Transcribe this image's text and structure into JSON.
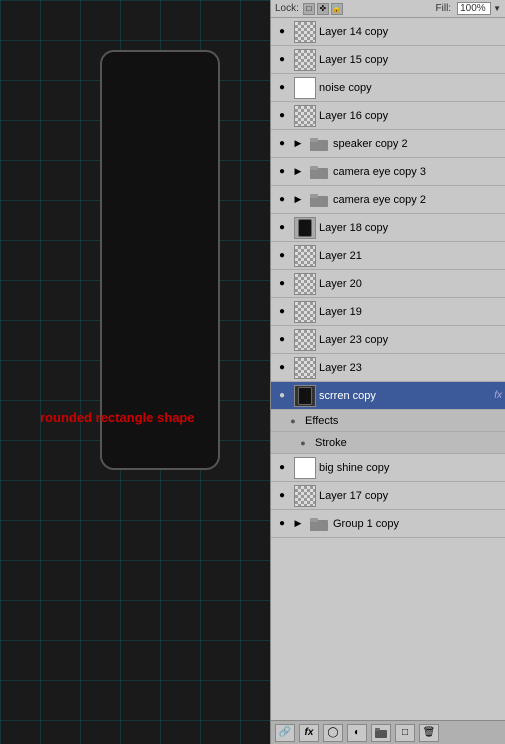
{
  "topBar": {
    "lockLabel": "Lock:",
    "fillLabel": "Fill:",
    "fillValue": "100%",
    "icons": [
      "lock-transparent",
      "lock-position",
      "lock-all"
    ]
  },
  "layers": [
    {
      "id": "layer14copy",
      "name": "Layer 14 copy",
      "type": "layer",
      "thumb": "checker",
      "visible": true,
      "selected": false,
      "fx": false
    },
    {
      "id": "layer15copy",
      "name": "Layer 15 copy",
      "type": "layer",
      "thumb": "checker",
      "visible": true,
      "selected": false,
      "fx": false
    },
    {
      "id": "noisecopy",
      "name": "noise copy",
      "type": "layer",
      "thumb": "white-bg",
      "visible": true,
      "selected": false,
      "fx": false
    },
    {
      "id": "layer16copy",
      "name": "Layer 16 copy",
      "type": "layer",
      "thumb": "checker",
      "visible": true,
      "selected": false,
      "fx": false
    },
    {
      "id": "speakercopy2",
      "name": "speaker copy 2",
      "type": "group",
      "visible": true,
      "selected": false,
      "expanded": false
    },
    {
      "id": "cameraeyecopy3",
      "name": "camera eye copy 3",
      "type": "group",
      "visible": true,
      "selected": false,
      "expanded": false
    },
    {
      "id": "cameraeyecopy2",
      "name": "camera eye copy 2",
      "type": "group",
      "visible": true,
      "selected": false,
      "expanded": false
    },
    {
      "id": "layer18copy",
      "name": "Layer 18 copy",
      "type": "layer",
      "thumb": "checker",
      "visible": true,
      "selected": false,
      "fx": false
    },
    {
      "id": "layer21",
      "name": "Layer 21",
      "type": "layer",
      "thumb": "checker",
      "visible": true,
      "selected": false,
      "fx": false
    },
    {
      "id": "layer20",
      "name": "Layer 20",
      "type": "layer",
      "thumb": "checker",
      "visible": true,
      "selected": false,
      "fx": false
    },
    {
      "id": "layer19",
      "name": "Layer 19",
      "type": "layer",
      "thumb": "checker",
      "visible": true,
      "selected": false,
      "fx": false
    },
    {
      "id": "layer23copy",
      "name": "Layer 23 copy",
      "type": "layer",
      "thumb": "checker",
      "visible": true,
      "selected": false,
      "fx": false
    },
    {
      "id": "layer23",
      "name": "Layer 23",
      "type": "layer",
      "thumb": "checker",
      "visible": true,
      "selected": false,
      "fx": false
    },
    {
      "id": "scrrencopY",
      "name": "scrren copy",
      "type": "layer",
      "thumb": "dark-bg",
      "visible": true,
      "selected": true,
      "fx": true
    },
    {
      "id": "effects-header",
      "name": "Effects",
      "type": "effects",
      "visible": true
    },
    {
      "id": "effects-stroke",
      "name": "Stroke",
      "type": "effect-item",
      "visible": true
    },
    {
      "id": "bigshinecopY",
      "name": "big shine copy",
      "type": "layer",
      "thumb": "white-bg",
      "visible": true,
      "selected": false,
      "fx": false
    },
    {
      "id": "layer17copy",
      "name": "Layer 17 copy",
      "type": "layer",
      "thumb": "checker",
      "visible": true,
      "selected": false,
      "fx": false
    },
    {
      "id": "group1copy",
      "name": "Group 1 copy",
      "type": "group",
      "visible": true,
      "selected": false,
      "expanded": false
    }
  ],
  "bottomBar": {
    "buttons": [
      "link-icon",
      "fx-icon",
      "mask-icon",
      "adjustment-icon",
      "folder-icon",
      "trash-icon"
    ]
  },
  "canvas": {
    "label": "rounded rectangle shape"
  }
}
